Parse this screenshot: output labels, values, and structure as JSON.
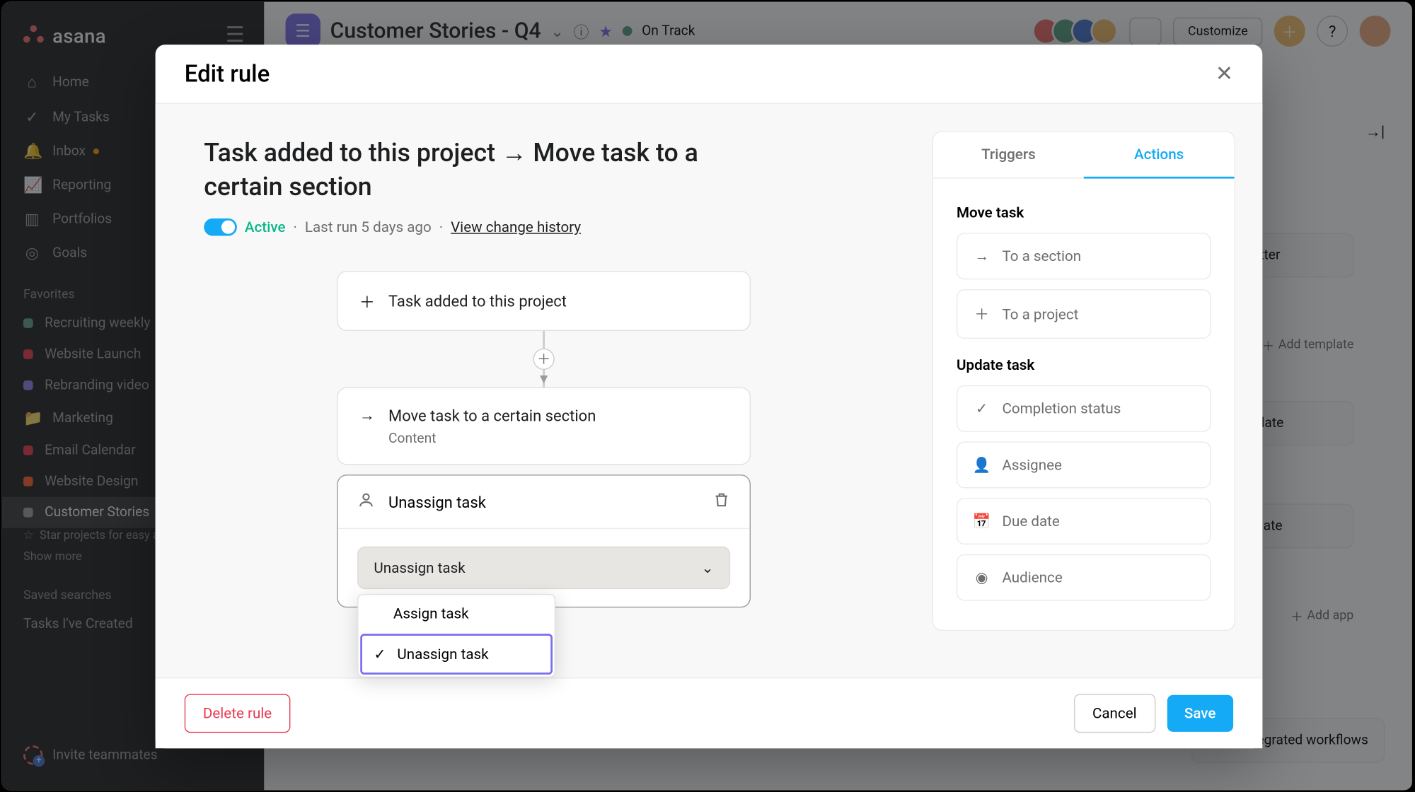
{
  "brand": "asana",
  "sidebar": {
    "items": [
      {
        "label": "Home"
      },
      {
        "label": "My Tasks"
      },
      {
        "label": "Inbox"
      },
      {
        "label": "Reporting"
      },
      {
        "label": "Portfolios"
      },
      {
        "label": "Goals"
      }
    ],
    "favorites_label": "Favorites",
    "favorites": [
      {
        "label": "Recruiting weekly",
        "color": "#5da283"
      },
      {
        "label": "Website Launch",
        "color": "#e8384f"
      },
      {
        "label": "Rebranding video",
        "color": "#8d84e8"
      },
      {
        "label": "Marketing",
        "color": "#f1bd6c"
      },
      {
        "label": "Email Calendar",
        "color": "#e8384f"
      },
      {
        "label": "Website Design",
        "color": "#fd612c"
      },
      {
        "label": "Customer Stories",
        "color": "#a2a0a2"
      }
    ],
    "star_hint": "Star projects for easy access",
    "show_more": "Show more",
    "saved_searches": "Saved searches",
    "tasks_created": "Tasks I've Created",
    "invite": "Invite teammates"
  },
  "project": {
    "title": "Customer Stories - Q4",
    "status": "On Track",
    "customize": "Customize",
    "add_template": "Add template",
    "add_app": "Add app",
    "cards": [
      "Newsletter",
      "",
      "plate",
      "ate",
      ""
    ],
    "workflow_card": "Build integrated workflows"
  },
  "modal": {
    "title": "Edit rule",
    "rule_title": "Task added to this project → Move task to a certain section",
    "active": "Active",
    "last_run": "Last run 5 days ago",
    "history": "View change history",
    "trigger_label": "Task added to this project",
    "action_label": "Move task to a certain section",
    "action_sub": "Content",
    "unassign_header": "Unassign task",
    "select_value": "Unassign task",
    "dropdown_assign": "Assign task",
    "dropdown_unassign": "Unassign task",
    "tabs": {
      "triggers": "Triggers",
      "actions": "Actions"
    },
    "panel": {
      "move_task": "Move task",
      "to_section": "To a section",
      "to_project": "To a project",
      "update_task": "Update task",
      "completion": "Completion status",
      "assignee": "Assignee",
      "due_date": "Due date",
      "audience": "Audience"
    },
    "buttons": {
      "delete": "Delete rule",
      "cancel": "Cancel",
      "save": "Save"
    }
  }
}
